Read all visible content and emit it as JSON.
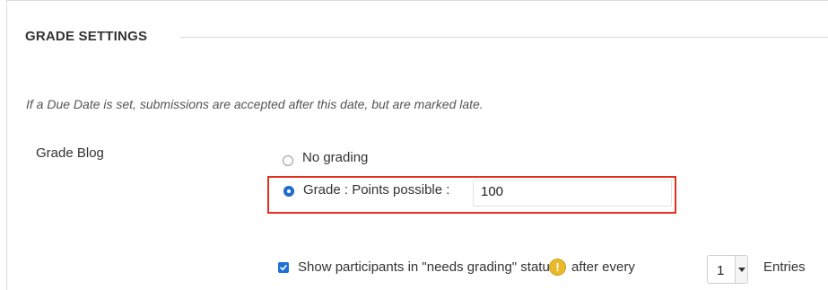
{
  "section": {
    "title": "GRADE SETTINGS"
  },
  "note": "If a Due Date is set, submissions are accepted after this date, but are marked late.",
  "grade_blog": {
    "label": "Grade Blog",
    "options": [
      {
        "label": "No grading",
        "selected": false
      },
      {
        "label": "Grade : Points possible :",
        "selected": true
      }
    ],
    "points_possible": "100"
  },
  "needs_grading": {
    "checked": true,
    "label_before": "Show participants in \"needs grading\" status",
    "warning_icon": "warning-icon",
    "after_every": "after every",
    "entries_value": "1",
    "entries_label": "Entries"
  },
  "colors": {
    "accent": "#1f6fd6",
    "highlight": "#e0301e",
    "warning": "#e9b92b"
  }
}
